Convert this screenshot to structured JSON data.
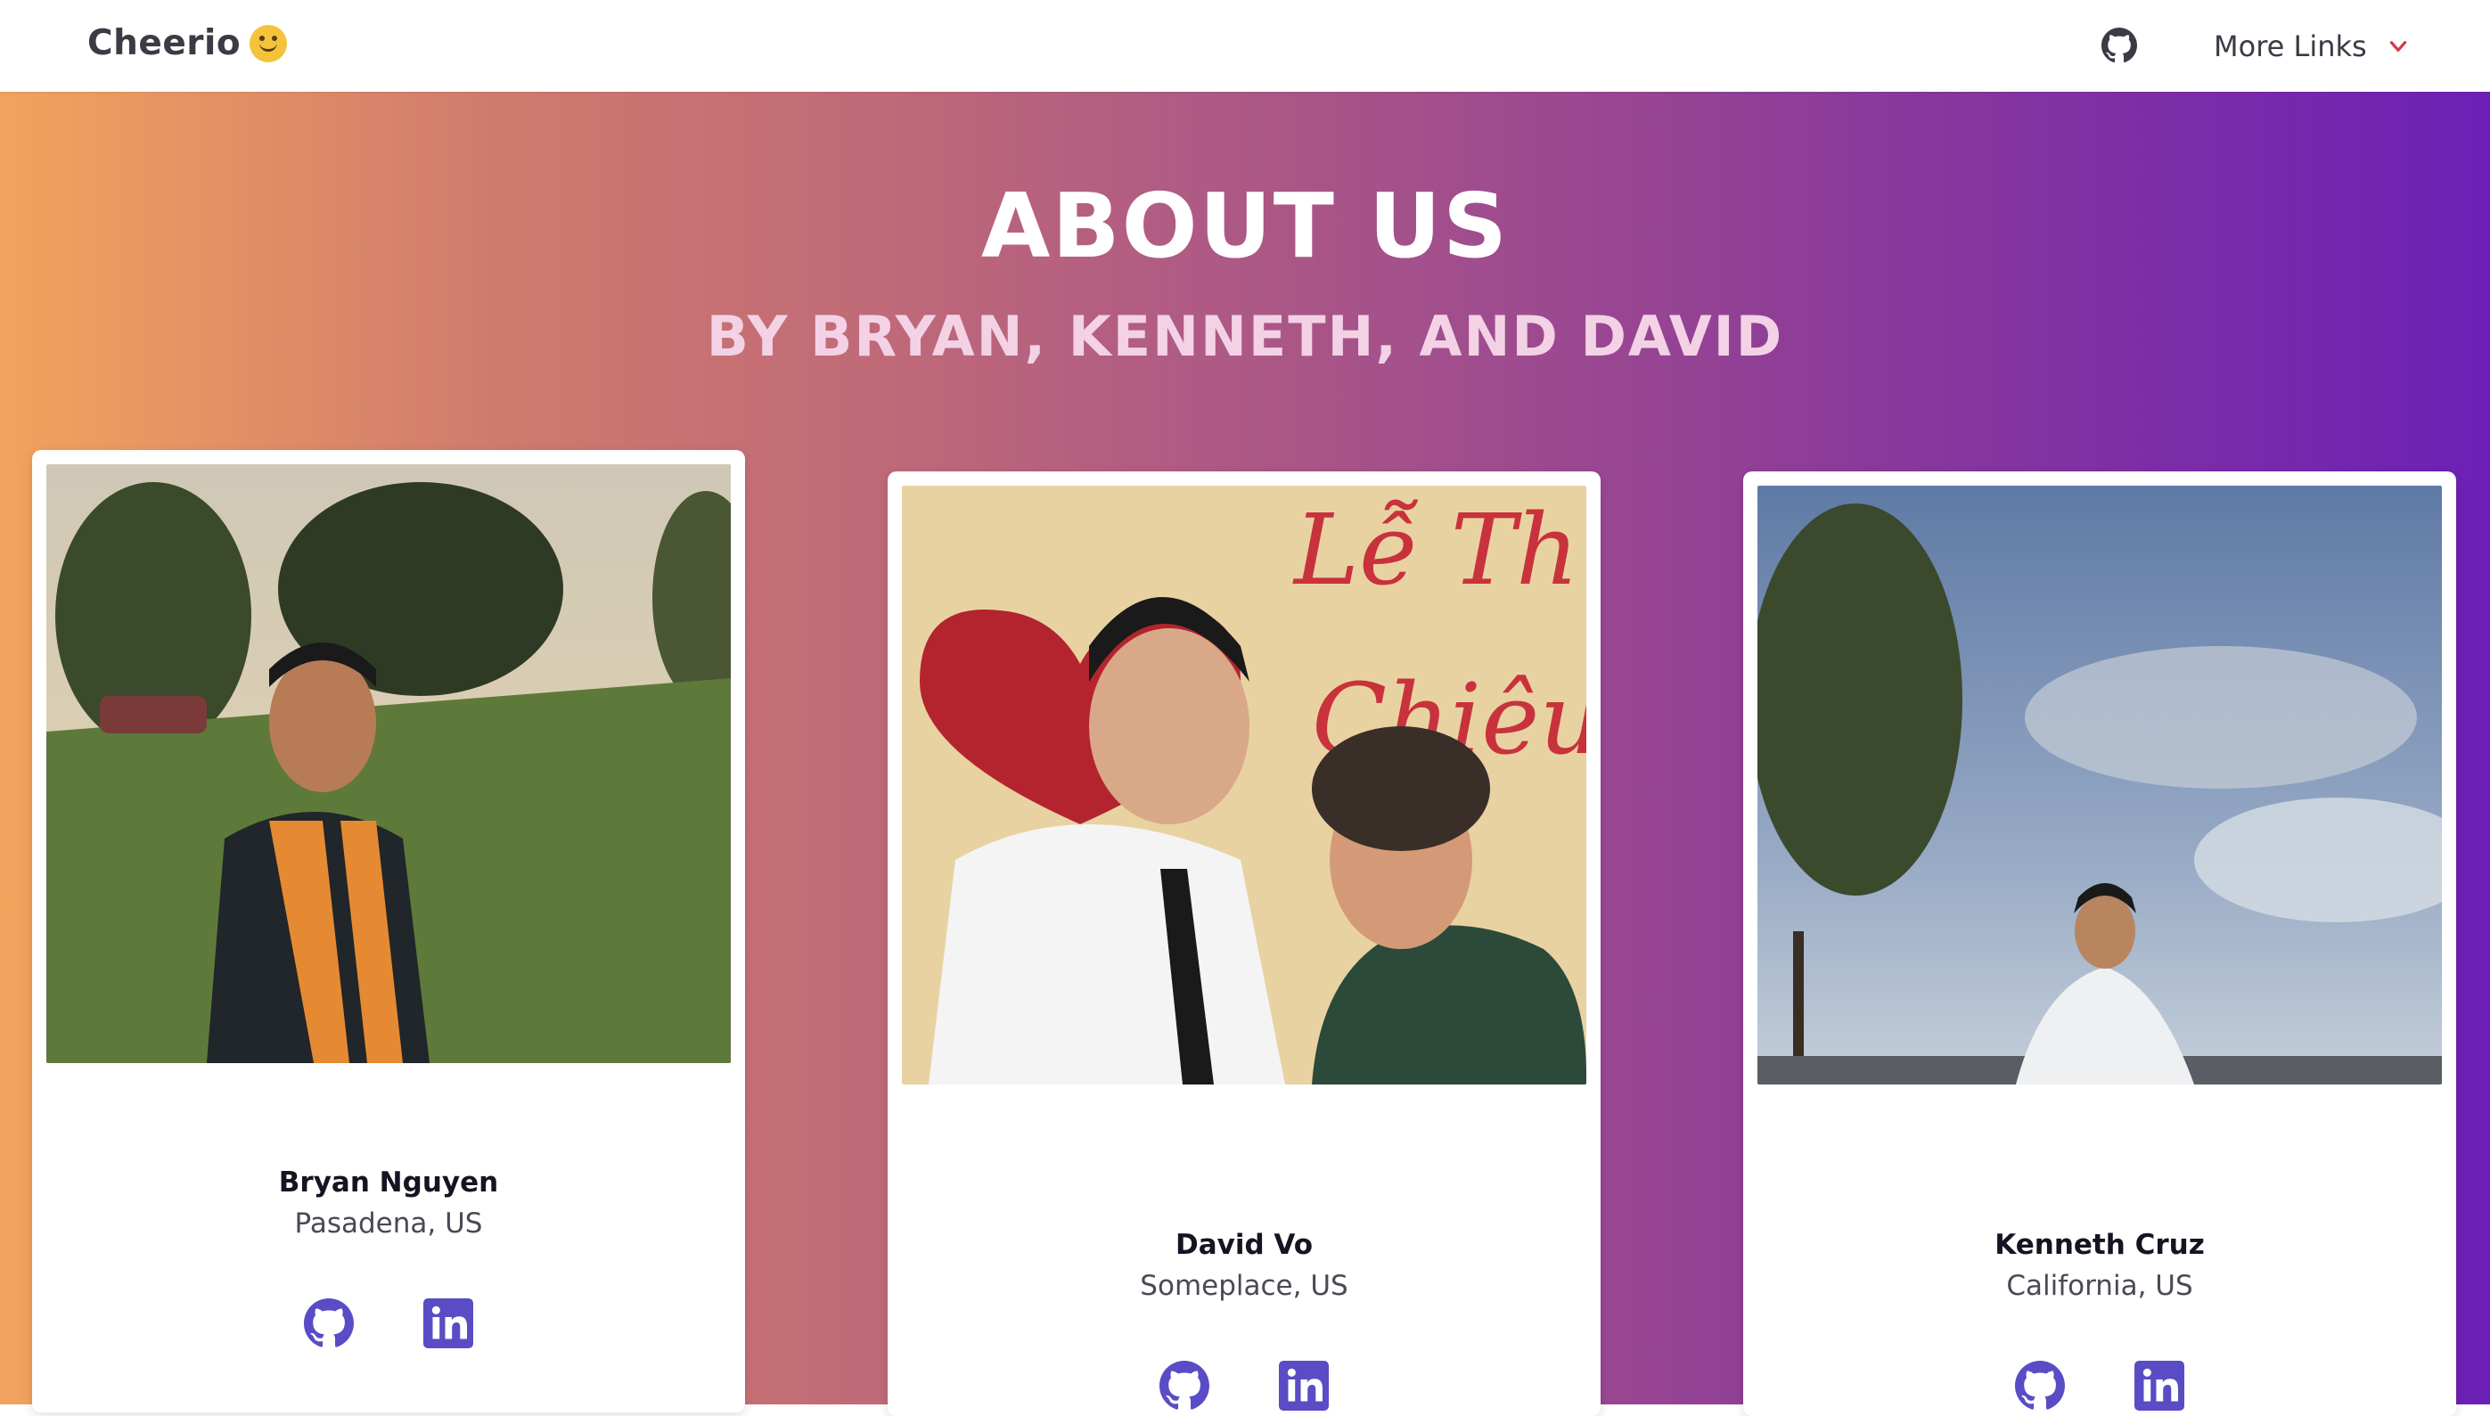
{
  "nav": {
    "brand": "Cheerio",
    "brand_emoji_icon": "hugging-face-emoji-icon",
    "github_icon": "github-icon",
    "more_links": "More Links",
    "more_links_icon": "chevron-down-icon"
  },
  "hero": {
    "title": "ABOUT US",
    "subtitle": "BY BRYAN, KENNETH, AND DAVID"
  },
  "team": [
    {
      "name": "Bryan Nguyen",
      "location": "Pasadena, US",
      "photo_icon": "person-photo",
      "links": [
        "github-icon",
        "linkedin-icon"
      ]
    },
    {
      "name": "David Vo",
      "location": "Someplace, US",
      "photo_icon": "person-photo",
      "links": [
        "github-icon",
        "linkedin-icon"
      ]
    },
    {
      "name": "Kenneth Cruz",
      "location": "California, US",
      "photo_icon": "person-photo",
      "links": [
        "github-icon",
        "linkedin-icon"
      ]
    }
  ],
  "colors": {
    "gradient_start": "#f2a35d",
    "gradient_end": "#6d20b6",
    "icon_color": "#5a4cc4",
    "chevron_color": "#d33a4a"
  }
}
